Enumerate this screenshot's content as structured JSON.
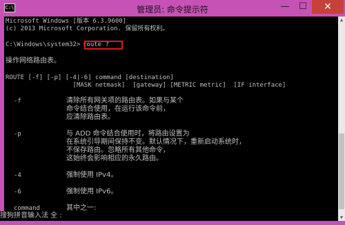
{
  "window": {
    "title": "管理员: 命令提示符",
    "icon": "cmd-icon",
    "icon_text": "C:\\",
    "minimize_label": "—",
    "maximize_label": "☐",
    "close_label": "✕"
  },
  "console": {
    "lines": [
      "Microsoft Windows [版本 6.3.9600]",
      "(c) 2013 Microsoft Corporation. 保留所有权利。",
      "C:\\Windows\\system32>",
      "route ?",
      "操作网络路由表。",
      "ROUTE [-f] [-p] [-4|-6] command [destination]",
      "                  [MASK netmask]  [gateway] [METRIC metric]  [IF interface]",
      "-f",
      "清除所有网关项的路由表。如果与某个",
      "命令结合使用，在运行该命令前，",
      "应清除路由表。",
      "-p",
      "与 ADD 命令结合使用时，将路由设置为",
      "在系统引导期间保持不变。默认情况下，重新启动系统时，",
      "不保存路由。忽略所有其他命令，",
      "这始终会影响相应的永久路由。",
      "-4",
      "强制使用 IPv4。",
      "-6",
      "强制使用 IPv6。",
      "command",
      "其中之一:"
    ]
  },
  "ime": {
    "text": "搜狗拼音输入法 全 :"
  },
  "colors": {
    "titlebar": "#c552b4",
    "console_bg": "#000000",
    "console_text": "#c0c0c0",
    "highlight": "#e0171d",
    "close_button": "#c7403a"
  }
}
